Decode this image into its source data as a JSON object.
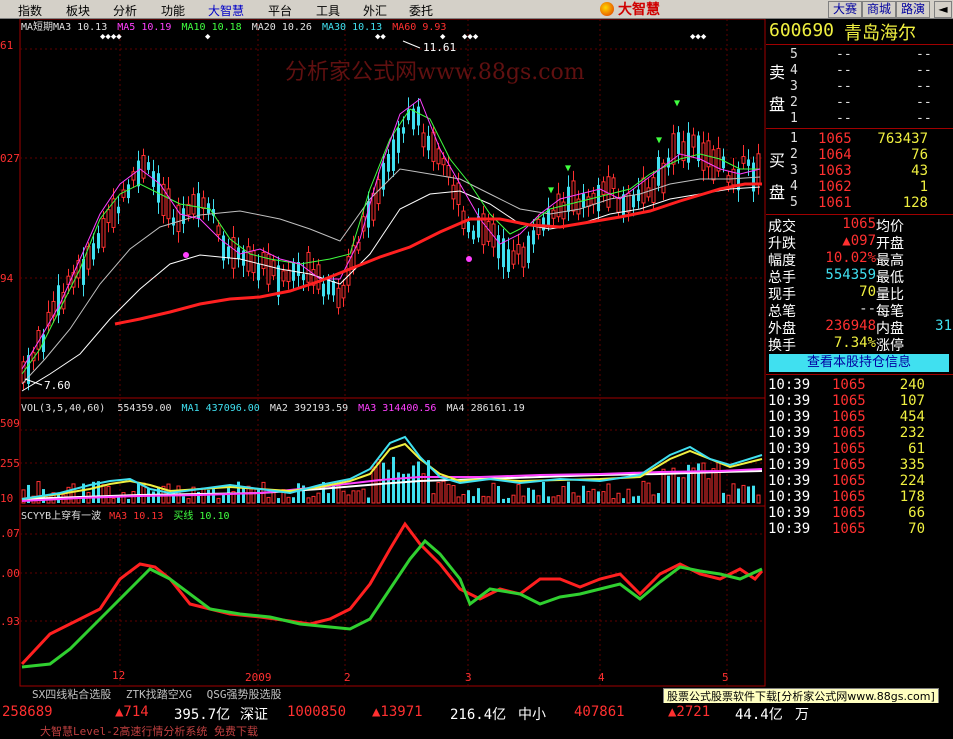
{
  "menu": {
    "items": [
      "指数",
      "板块",
      "分析",
      "功能",
      "大智慧",
      "平台",
      "工具",
      "外汇",
      "委托"
    ],
    "brand": "大智慧",
    "right_buttons": [
      "大赛",
      "商城",
      "路演"
    ]
  },
  "indicator_main": {
    "ma_short": "MA短期MA3 10.13",
    "ma5": "MA5 10.19",
    "ma10": "MA10 10.18",
    "ma20": "MA20 10.26",
    "ma30": "MA30 10.13",
    "ma60": "MA60 9.93",
    "high_label": "11.61",
    "low_label": "7.60",
    "watermark": "分析家公式网www.88gs.com",
    "y_ticks": [
      "61",
      "027",
      "94"
    ]
  },
  "indicator_vol": {
    "vol": "VOL(3,5,40,60)",
    "vol_val": "554359.00",
    "ma1": "MA1 437096.00",
    "ma2": "MA2 392193.59",
    "ma3": "MA3 314400.56",
    "ma4": "MA4 286161.19",
    "y_ticks": [
      "509",
      "255",
      "10"
    ]
  },
  "indicator_sc": {
    "name": "SCYYB上穿有一波",
    "ma3": "MA3 10.13",
    "buy": "买线 10.10",
    "y_ticks": [
      ".07",
      ".00",
      ".93"
    ]
  },
  "x_axis": [
    "12",
    "2009",
    "2",
    "3",
    "4",
    "5"
  ],
  "stock": {
    "code": "600690",
    "name": "青岛海尔"
  },
  "sell": {
    "label_top": "卖",
    "label_bottom": "盘",
    "rows": [
      {
        "n": "5",
        "price": "--",
        "vol": "--"
      },
      {
        "n": "4",
        "price": "--",
        "vol": "--"
      },
      {
        "n": "3",
        "price": "--",
        "vol": "--"
      },
      {
        "n": "2",
        "price": "--",
        "vol": "--"
      },
      {
        "n": "1",
        "price": "--",
        "vol": "--"
      }
    ]
  },
  "buy": {
    "label_top": "买",
    "label_bottom": "盘",
    "rows": [
      {
        "n": "1",
        "price": "1065",
        "vol": "763437"
      },
      {
        "n": "2",
        "price": "1064",
        "vol": "76"
      },
      {
        "n": "3",
        "price": "1063",
        "vol": "43"
      },
      {
        "n": "4",
        "price": "1062",
        "vol": "1"
      },
      {
        "n": "5",
        "price": "1061",
        "vol": "128"
      }
    ]
  },
  "quote": [
    {
      "l1": "成交",
      "v1": "1065",
      "l2": "均价",
      "v2": ""
    },
    {
      "l1": "升跌",
      "v1": "▲097",
      "l2": "开盘",
      "v2": ""
    },
    {
      "l1": "幅度",
      "v1": "10.02%",
      "l2": "最高",
      "v2": ""
    },
    {
      "l1": "总手",
      "v1": "554359",
      "l2": "最低",
      "v2": ""
    },
    {
      "l1": "现手",
      "v1": "70",
      "l2": "量比",
      "v2": ""
    },
    {
      "l1": "总笔",
      "v1": "--",
      "l2": "每笔",
      "v2": ""
    },
    {
      "l1": "外盘",
      "v1": "236948",
      "l2": "内盘",
      "v2": "31"
    },
    {
      "l1": "换手",
      "v1": "7.34%",
      "l2": "涨停",
      "v2": ""
    }
  ],
  "hold_button": "查看本股持仓信息",
  "ticks": [
    {
      "t": "10:39",
      "p": "1065",
      "v": "240"
    },
    {
      "t": "10:39",
      "p": "1065",
      "v": "107"
    },
    {
      "t": "10:39",
      "p": "1065",
      "v": "454"
    },
    {
      "t": "10:39",
      "p": "1065",
      "v": "232"
    },
    {
      "t": "10:39",
      "p": "1065",
      "v": "61"
    },
    {
      "t": "10:39",
      "p": "1065",
      "v": "335"
    },
    {
      "t": "10:39",
      "p": "1065",
      "v": "224"
    },
    {
      "t": "10:39",
      "p": "1065",
      "v": "178"
    },
    {
      "t": "10:39",
      "p": "1065",
      "v": "66"
    },
    {
      "t": "10:39",
      "p": "1065",
      "v": "70"
    }
  ],
  "bottom_tabs": [
    "SX四线粘合选股",
    "ZTK找踏空XG",
    "QSG强势股选股"
  ],
  "tooltip": "股票公式股票软件下载[分析家公式网www.88gs.com]",
  "status": {
    "a": "258689",
    "b": "▲714",
    "c": "395.7亿",
    "d": "深证",
    "e": "1000850",
    "f": "▲13971",
    "g": "216.4亿",
    "h": "中小",
    "i": "407861",
    "j": "▲2721",
    "k": "44.4亿",
    "l": "万"
  },
  "scroll_text": "大智慧Level-2高速行情分析系统 免费下载",
  "colors": {
    "red": "#ff3030",
    "cyan": "#40e0f0",
    "green": "#30d030",
    "yellow": "#f0f040"
  }
}
